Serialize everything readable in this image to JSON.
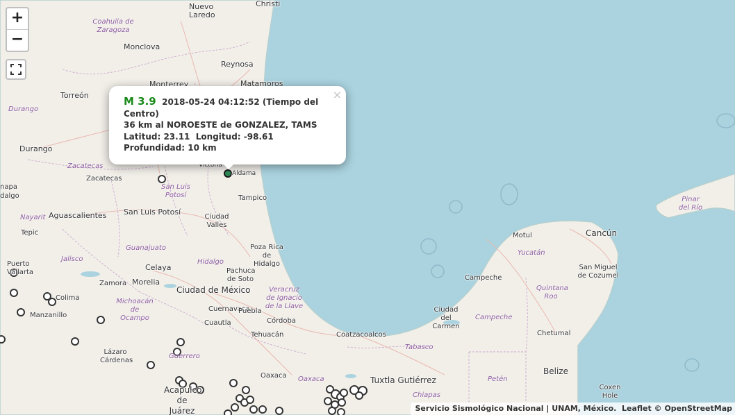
{
  "controls": {
    "zoom_in_label": "+",
    "zoom_out_label": "−",
    "fullscreen_icon": "fullscreen-icon"
  },
  "popup": {
    "magnitude": "M 3.9",
    "datetime": "2018-05-24  04:12:52 (Tiempo del Centro)",
    "location_prefix": "36 km al",
    "direction": "NOROESTE",
    "location_mid": "de",
    "place": "GONZALEZ, TAMS",
    "lat_label": "Latitud:",
    "lat_value": "23.11",
    "lon_label": "Longitud:",
    "lon_value": "-98.61",
    "depth_label": "Profundidad:",
    "depth_value": "10 km",
    "close_label": "×"
  },
  "attribution": {
    "source": "Servicio Sismológico Nacional | UNAM, México.",
    "leaflet": "Leaflet",
    "osm": "© OpenStreetMap"
  },
  "colors": {
    "water": "#aad3df",
    "land": "#f2efe9",
    "selected_marker": "#2e8b57",
    "marker_stroke": "#333333"
  },
  "map": {
    "cities": [
      "Christi",
      "Nuevo Laredo",
      "Monclova",
      "Reynosa",
      "Monterrey",
      "Matamoros",
      "Torreón",
      "Durango",
      "Victoria",
      "Aldama",
      "Zacatecas",
      "Tampico",
      "Aguascalientes",
      "San Luis Potosí",
      "Ciudad Valles",
      "Tepic",
      "Poza Rica de Hidalgo",
      "Puerto Vallarta",
      "Celaya",
      "Pachuca de Soto",
      "Zamora",
      "Morelia",
      "Ciudad de México",
      "Colima",
      "Manzanillo",
      "Cuernavaca",
      "Puebla",
      "Cuautla",
      "Córdoba",
      "Tehuacán",
      "Coatzacoalcos",
      "Lázaro Cárdenas",
      "Oaxaca",
      "Tuxtla Gutiérrez",
      "Acapulco de Juárez",
      "Motul",
      "Cancún",
      "Campeche",
      "San Miguel de Cozumel",
      "Ciudad del Carmen",
      "Chetumal",
      "Belize",
      "Coxen Hole"
    ],
    "states": [
      "Coahuila de Zaragoza",
      "Durango",
      "Zacatecas",
      "San Luis Potosí",
      "Nayarit",
      "Jalisco",
      "Guanajuato",
      "Hidalgo",
      "Michoacán de Ocampo",
      "Veracruz de Ignacio de la Llave",
      "Guerrero",
      "Oaxaca",
      "Tabasco",
      "Chiapas",
      "Yucatán",
      "Quintana Roo",
      "Campeche",
      "Petén",
      "Pinar del Río"
    ],
    "partial_labels": [
      "napa",
      "dalgo"
    ]
  }
}
